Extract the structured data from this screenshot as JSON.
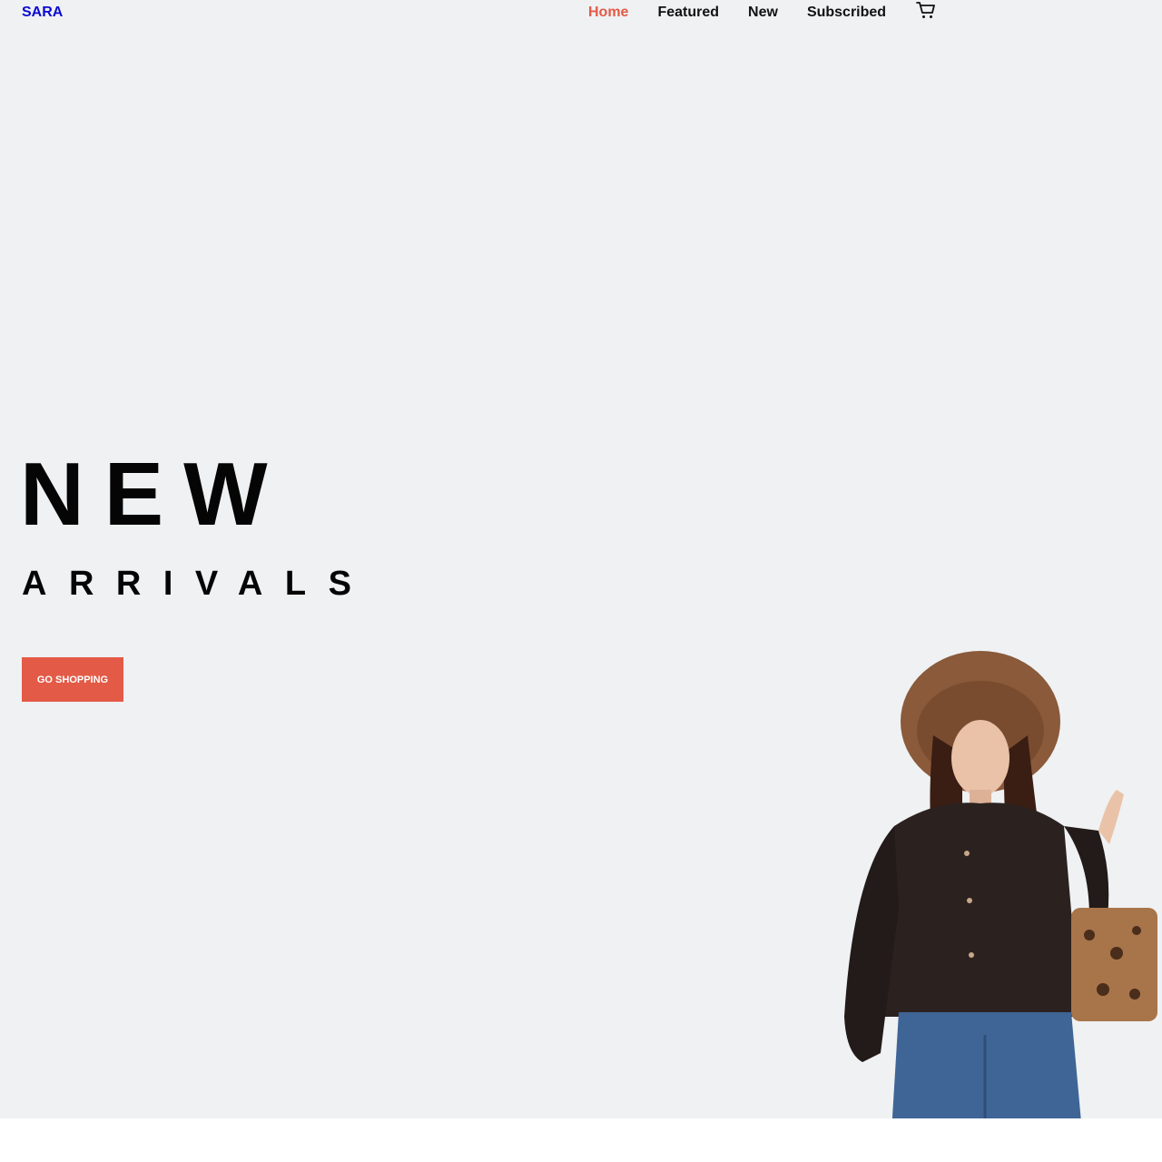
{
  "brand": {
    "logo_text": "SARA",
    "logo_color": "#0a0ad2"
  },
  "nav": {
    "items": [
      {
        "label": "Home",
        "active": true
      },
      {
        "label": "Featured",
        "active": false
      },
      {
        "label": "New",
        "active": false
      },
      {
        "label": "Subscribed",
        "active": false
      }
    ],
    "cart_icon": "cart-icon",
    "active_color": "#e35a46"
  },
  "hero": {
    "headline": "NEW",
    "subheadline": "ARRIVALS",
    "cta_label": "GO SHOPPING",
    "cta_color": "#e35a46",
    "background": "#eff1f3",
    "image": "model-photo"
  }
}
